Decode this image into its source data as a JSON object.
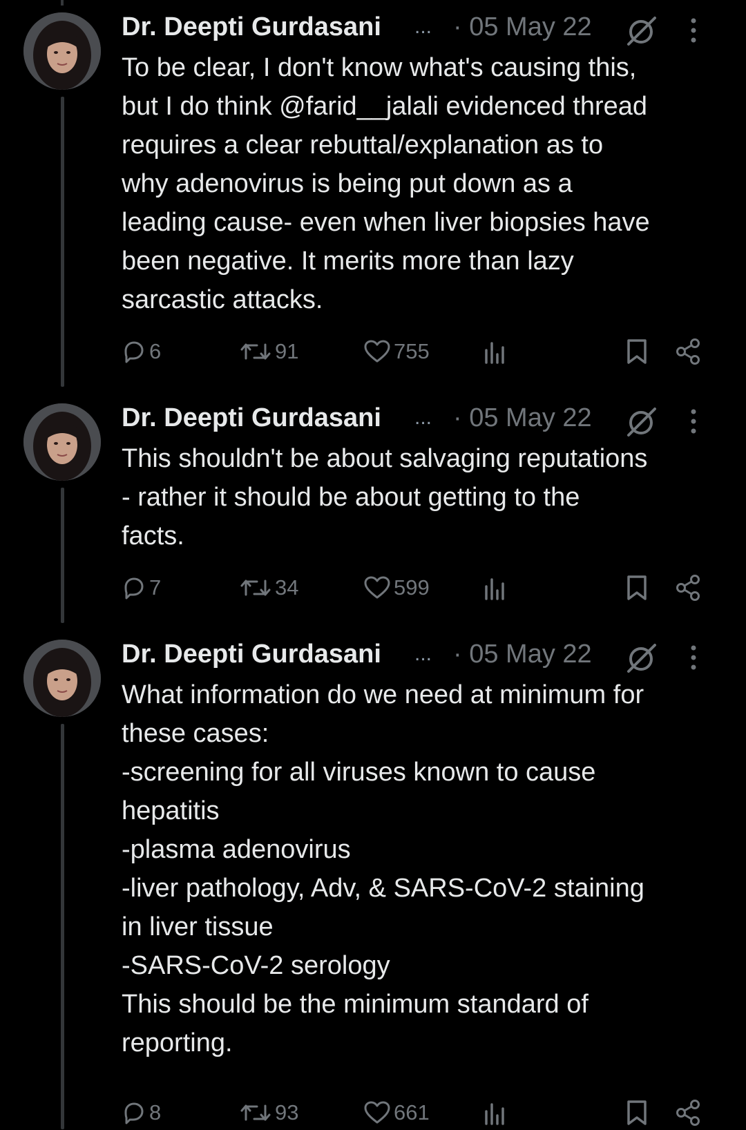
{
  "tweets": [
    {
      "author": "Dr. Deepti Gurdasani",
      "ellipsis": "...",
      "date": "· 05 May 22",
      "text": "To be clear, I don't know what's causing this,\nbut I do think @farid__jalali evidenced thread\nrequires a clear rebuttal/explanation as to\nwhy adenovirus is being put down as a\nleading cause- even when liver biopsies have\nbeen negative. It merits more than lazy\nsarcastic attacks.",
      "replies": "6",
      "retweets": "91",
      "likes": "755"
    },
    {
      "author": "Dr. Deepti Gurdasani",
      "ellipsis": "...",
      "date": "· 05 May 22",
      "text": "This shouldn't be about salvaging reputations\n- rather it should be about getting to the\nfacts.",
      "replies": "7",
      "retweets": "34",
      "likes": "599"
    },
    {
      "author": "Dr. Deepti Gurdasani",
      "ellipsis": "...",
      "date": "· 05 May 22",
      "text": "What information do we need at minimum for\nthese cases:\n-screening for all viruses known to cause\nhepatitis\n-plasma adenovirus\n-liver pathology, Adv, & SARS-CoV-2 staining\nin liver tissue\n-SARS-CoV-2 serology\nThis should be the minimum standard of\nreporting.",
      "replies": "8",
      "retweets": "93",
      "likes": "661"
    }
  ],
  "icons": {
    "reply": "reply-icon",
    "retweet": "retweet-icon",
    "like": "heart-icon",
    "views": "analytics-icon",
    "bookmark": "bookmark-icon",
    "share": "share-icon",
    "grok": "grok-icon",
    "more": "more-vertical-icon"
  },
  "colors": {
    "background": "#000000",
    "text": "#e7e9ea",
    "muted": "#71767b",
    "thread_line": "#333639"
  }
}
